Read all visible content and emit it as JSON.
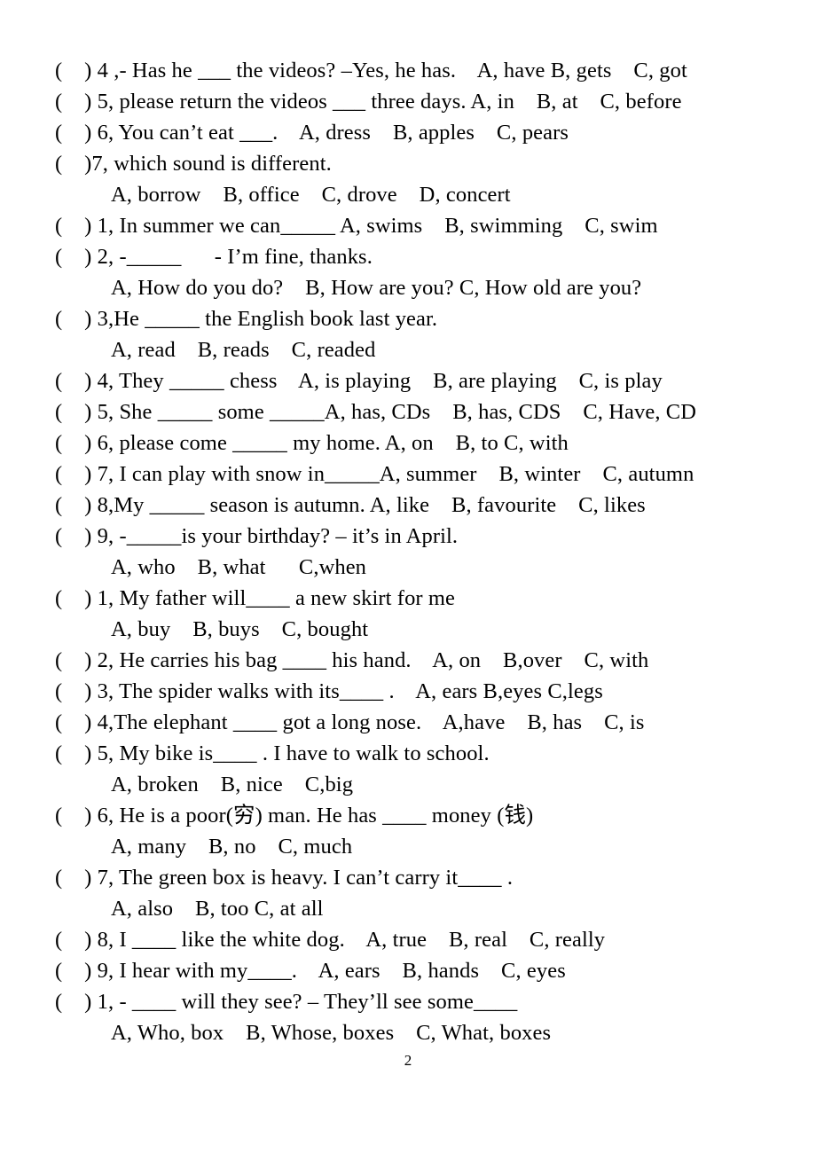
{
  "document": {
    "page_number": "2",
    "lines": [
      {
        "id": "q-a4",
        "indent": false,
        "text": "(    ) 4 ,- Has he ___ the videos? –Yes, he has.    A, have B, gets    C, got"
      },
      {
        "id": "q-a5",
        "indent": false,
        "text": "(    ) 5, please return the videos ___ three days. A, in    B, at    C, before"
      },
      {
        "id": "q-a6",
        "indent": false,
        "text": "(    ) 6, You can’t eat ___.    A, dress    B, apples    C, pears"
      },
      {
        "id": "q-a7",
        "indent": false,
        "text": "(    )7, which sound is different."
      },
      {
        "id": "o-a7",
        "indent": true,
        "text": "A, borrow    B, office    C, drove    D, concert"
      },
      {
        "id": "q-b1",
        "indent": false,
        "text": "(    ) 1, In summer we can_____ A, swims    B, swimming    C, swim"
      },
      {
        "id": "q-b2",
        "indent": false,
        "text": "(    ) 2, -_____      - I’m fine, thanks."
      },
      {
        "id": "o-b2",
        "indent": true,
        "text": "A, How do you do?    B, How are you? C, How old are you?"
      },
      {
        "id": "q-b3",
        "indent": false,
        "text": "(    ) 3,He _____ the English book last year."
      },
      {
        "id": "o-b3",
        "indent": true,
        "text": "A, read    B, reads    C, readed"
      },
      {
        "id": "q-b4",
        "indent": false,
        "text": "(    ) 4, They _____ chess    A, is playing    B, are playing    C, is play"
      },
      {
        "id": "q-b5",
        "indent": false,
        "text": "(    ) 5, She _____ some _____A, has, CDs    B, has, CDS    C, Have, CD"
      },
      {
        "id": "q-b6",
        "indent": false,
        "text": "(    ) 6, please come _____ my home. A, on    B, to C, with"
      },
      {
        "id": "q-b7",
        "indent": false,
        "text": "(    ) 7, I can play with snow in_____A, summer    B, winter    C, autumn"
      },
      {
        "id": "q-b8",
        "indent": false,
        "text": "(    ) 8,My _____ season is autumn. A, like    B, favourite    C, likes"
      },
      {
        "id": "q-b9",
        "indent": false,
        "text": "(    ) 9, -_____is your birthday? – it’s in April."
      },
      {
        "id": "o-b9",
        "indent": true,
        "text": "A, who    B, what      C,when"
      },
      {
        "id": "q-c1",
        "indent": false,
        "text": "(    ) 1, My father will____ a new skirt for me"
      },
      {
        "id": "o-c1",
        "indent": true,
        "text": "A, buy    B, buys    C, bought"
      },
      {
        "id": "q-c2",
        "indent": false,
        "text": "(    ) 2, He carries his bag ____ his hand.    A, on    B,over    C, with"
      },
      {
        "id": "q-c3",
        "indent": false,
        "text": "(    ) 3, The spider walks with its____ .    A, ears B,eyes C,legs"
      },
      {
        "id": "q-c4",
        "indent": false,
        "text": "(    ) 4,The elephant ____ got a long nose.    A,have    B, has    C, is"
      },
      {
        "id": "q-c5",
        "indent": false,
        "text": "(    ) 5, My bike is____ . I have to walk to school."
      },
      {
        "id": "o-c5",
        "indent": true,
        "text": "A, broken    B, nice    C,big"
      },
      {
        "id": "q-c6",
        "indent": false,
        "text": "(    ) 6, He is a poor(穷) man. He has ____ money (钱)"
      },
      {
        "id": "o-c6",
        "indent": true,
        "text": "A, many    B, no    C, much"
      },
      {
        "id": "q-c7",
        "indent": false,
        "text": "(    ) 7, The green box is heavy. I can’t carry it____ ."
      },
      {
        "id": "o-c7",
        "indent": true,
        "text": "A, also    B, too C, at all"
      },
      {
        "id": "q-c8",
        "indent": false,
        "text": "(    ) 8, I ____ like the white dog.    A, true    B, real    C, really"
      },
      {
        "id": "q-c9",
        "indent": false,
        "text": "(    ) 9, I hear with my____.    A, ears    B, hands    C, eyes"
      },
      {
        "id": "q-d1",
        "indent": false,
        "text": "(    ) 1, - ____ will they see? – They’ll see some____"
      },
      {
        "id": "o-d1",
        "indent": true,
        "text": "A, Who, box    B, Whose, boxes    C, What, boxes"
      }
    ]
  }
}
